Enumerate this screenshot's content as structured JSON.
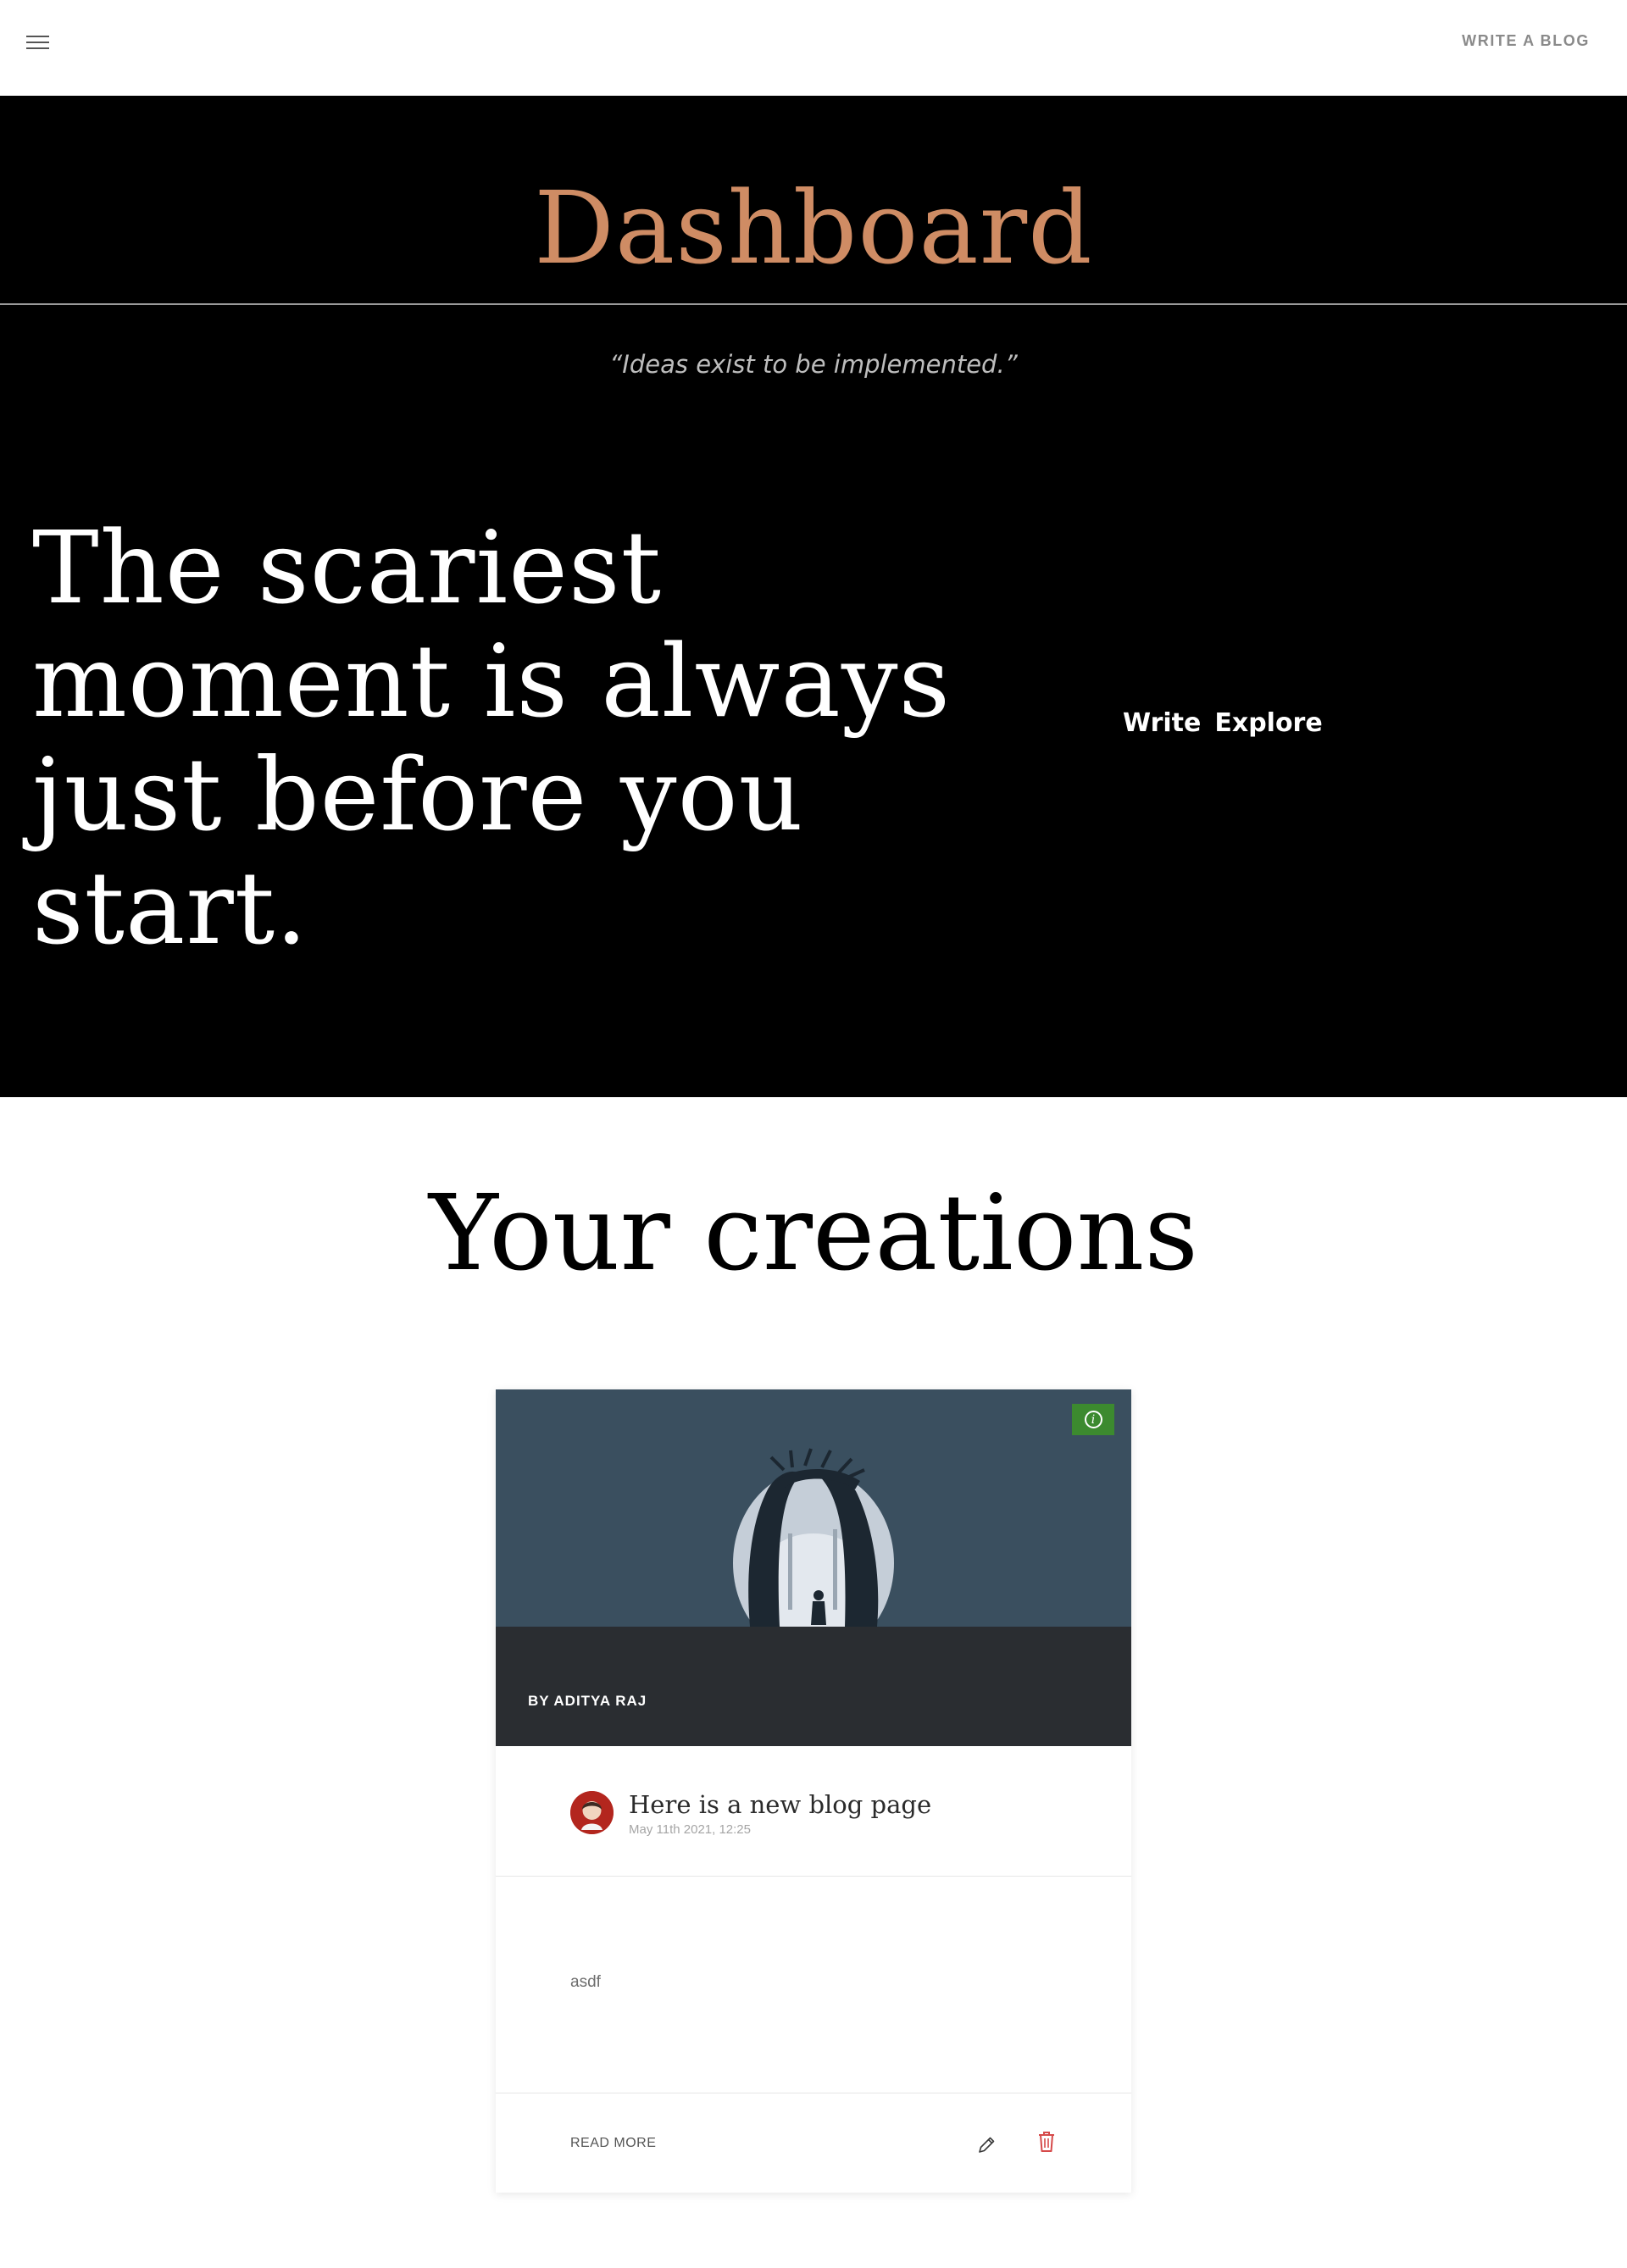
{
  "topbar": {
    "menu_icon": "hamburger-menu-icon",
    "write_link": "WRITE A BLOG"
  },
  "hero": {
    "title": "Dashboard",
    "quote": "“Ideas exist to be implemented.”",
    "headline_lines": [
      "The scariest",
      "moment is always",
      "just before you",
      "start."
    ],
    "links": {
      "write": "Write",
      "explore": "Explore"
    },
    "colors": {
      "background": "#000000",
      "title": "#cf8c64",
      "text": "#ffffff"
    }
  },
  "creations": {
    "title": "Your creations",
    "cards": [
      {
        "image": "forest-silhouette-illustration",
        "info_icon": "info-icon",
        "byline": "BY ADITYA RAJ",
        "avatar": "user-avatar",
        "post_title": "Here is a new blog page",
        "date": "May 11th 2021, 12:25",
        "excerpt": "asdf",
        "read_more": "READ MORE",
        "edit_icon": "pencil-icon",
        "delete_icon": "trash-icon",
        "colors": {
          "info_button": "#3c8a2f",
          "delete": "#d64a4a",
          "byline_bar": "#2a2d31",
          "image_bg": "#3a4f5f"
        }
      }
    ]
  }
}
